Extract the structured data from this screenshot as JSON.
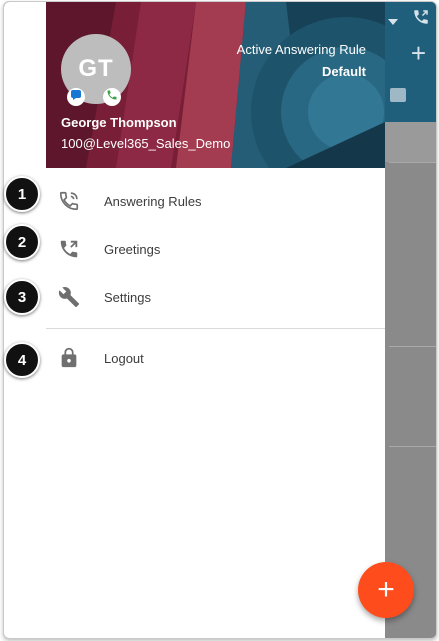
{
  "profile": {
    "avatar_initials": "GT",
    "name": "George Thompson",
    "extension": "100@Level365_Sales_Demo",
    "answering_rule_label": "Active Answering Rule",
    "answering_rule_value": "Default",
    "status_icons": [
      "chat-icon",
      "phone-icon"
    ]
  },
  "menu": {
    "items": [
      {
        "label": "Answering Rules",
        "icon": "phone-forward-icon"
      },
      {
        "label": "Greetings",
        "icon": "phone-greeting-icon"
      },
      {
        "label": "Settings",
        "icon": "wrench-icon"
      },
      {
        "label": "Logout",
        "icon": "lock-icon"
      }
    ]
  },
  "callouts": [
    "1",
    "2",
    "3",
    "4"
  ],
  "fab": {
    "label": "+",
    "icon": "plus-icon"
  },
  "app_header": {
    "plus_label": "+"
  },
  "colors": {
    "accent": "#ff4c1d",
    "header_blue": "#1f5f7c",
    "header_red": "#9e2b45",
    "icon_gray": "#6f6f6f"
  }
}
